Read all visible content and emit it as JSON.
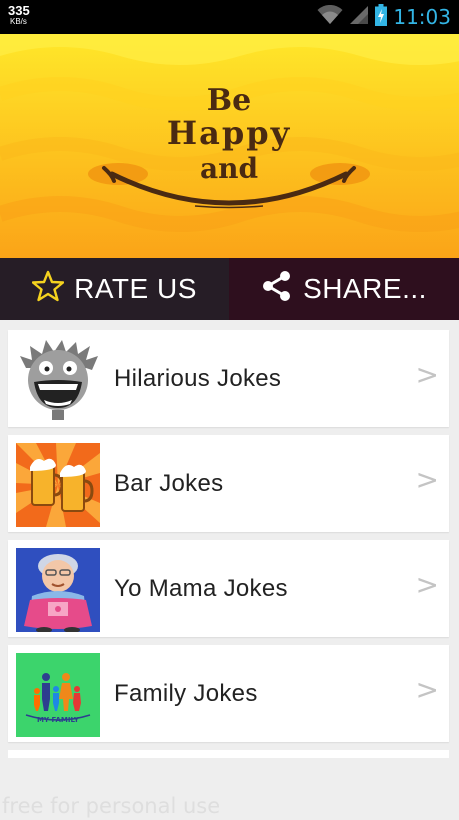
{
  "status_bar": {
    "net_speed": "335",
    "net_unit": "KB/s",
    "clock": "11:03",
    "icons": [
      "wifi-icon",
      "signal-icon",
      "battery-charging-icon"
    ]
  },
  "banner": {
    "line1": "Be",
    "line2": "Happy",
    "line3": "and",
    "colors": {
      "top": "#fde21e",
      "bottom": "#fca21a",
      "text": "#4a2a12",
      "cheek": "#f39c12"
    }
  },
  "actions": {
    "rate_label": "RATE US",
    "share_label": "SHARE...",
    "rate_icon": "star-outline-icon",
    "share_icon": "share-icon"
  },
  "list": {
    "items": [
      {
        "label": "Hilarious Jokes",
        "icon": "laughing-face-icon",
        "chevron": ">"
      },
      {
        "label": "Bar Jokes",
        "icon": "beer-mugs-icon",
        "chevron": ">"
      },
      {
        "label": "Yo Mama Jokes",
        "icon": "grandma-icon",
        "chevron": ">"
      },
      {
        "label": "Family Jokes",
        "icon": "family-icon",
        "thumb_text": "MY FAMILY",
        "chevron": ">"
      }
    ]
  },
  "watermark": "free for personal use"
}
